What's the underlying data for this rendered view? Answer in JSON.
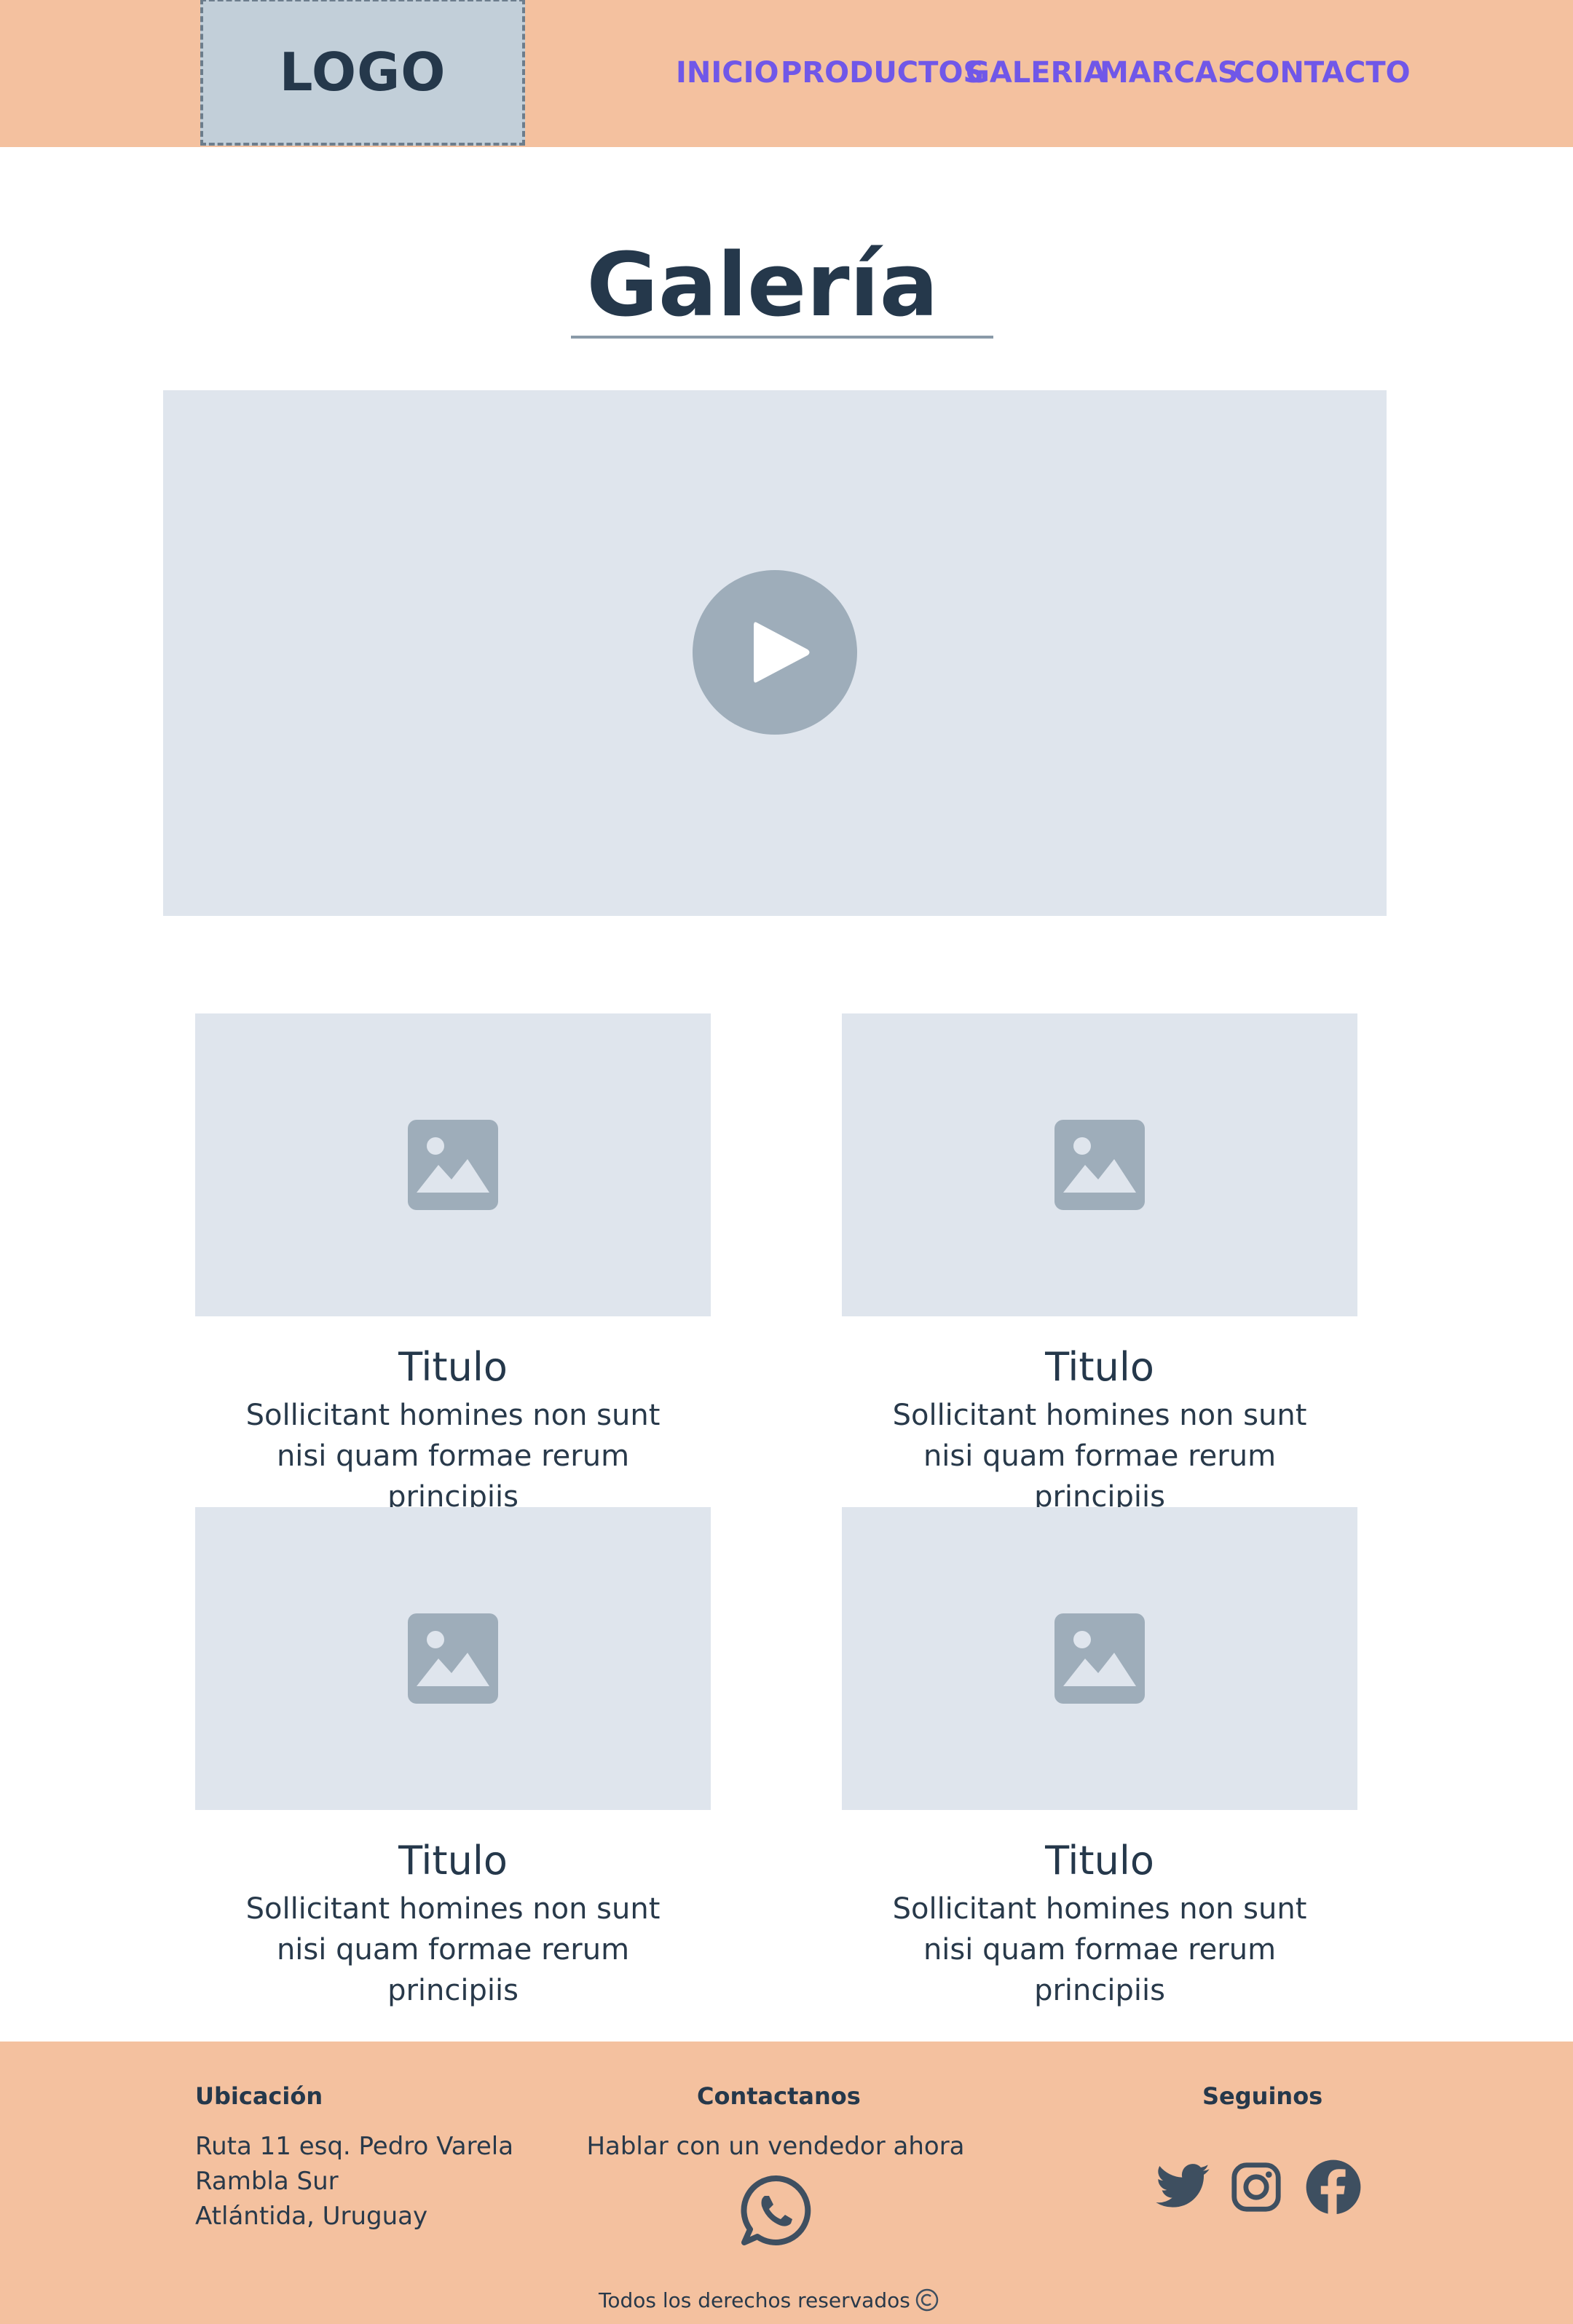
{
  "header": {
    "logo": "LOGO",
    "nav": [
      "INICIO",
      "PRODUCTOS",
      "GALERIA",
      "MARCAS",
      "CONTACTO"
    ]
  },
  "main": {
    "title": "Galería",
    "cards": [
      {
        "title": "Titulo",
        "desc": "Sollicitant homines non sunt nisi quam formae rerum principiis"
      },
      {
        "title": "Titulo",
        "desc": "Sollicitant homines non sunt nisi quam formae rerum principiis"
      },
      {
        "title": "Titulo",
        "desc": "Sollicitant homines non sunt nisi quam formae rerum principiis"
      },
      {
        "title": "Titulo",
        "desc": "Sollicitant homines non sunt nisi quam formae rerum principiis"
      }
    ]
  },
  "footer": {
    "location_heading": "Ubicación",
    "address": [
      "Ruta 11 esq. Pedro Varela",
      "Rambla Sur",
      "Atlántida, Uruguay"
    ],
    "contact_heading": "Contactanos",
    "contact_text": "Hablar con un vendedor ahora",
    "follow_heading": "Seguinos",
    "social_icons": [
      "twitter-icon",
      "instagram-icon",
      "facebook-icon"
    ],
    "copyright": "Todos los derechos reservados"
  },
  "colors": {
    "header_bg": "#f4c19f",
    "nav_link": "#7057e8",
    "placeholder_bg": "#dfe5ed",
    "placeholder_icon": "#9eadba",
    "text_dark": "#25384b"
  }
}
